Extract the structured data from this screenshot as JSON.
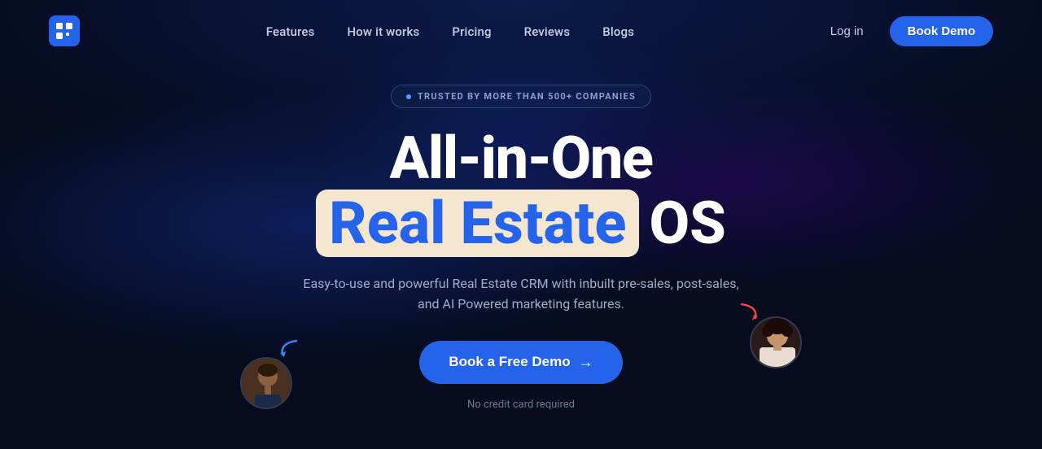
{
  "nav": {
    "logo_alt": "Reelo Logo",
    "links": [
      {
        "label": "Features",
        "href": "#"
      },
      {
        "label": "How it works",
        "href": "#"
      },
      {
        "label": "Pricing",
        "href": "#"
      },
      {
        "label": "Reviews",
        "href": "#"
      },
      {
        "label": "Blogs",
        "href": "#"
      }
    ],
    "login_label": "Log in",
    "book_demo_label": "Book Demo"
  },
  "hero": {
    "badge_text": "TRUSTED BY MORE THAN 500+ COMPANIES",
    "title_line1": "All-in-One",
    "title_highlight": "Real Estate",
    "title_suffix": "OS",
    "subtitle": "Easy-to-use and powerful Real Estate CRM with inbuilt pre-sales, post-sales, and AI Powered marketing features.",
    "cta_label": "Book a Free Demo",
    "cta_arrow": "→",
    "no_credit_text": "No credit card required"
  },
  "colors": {
    "accent": "#2563eb",
    "highlight_bg": "#f5e6d0",
    "highlight_text": "#2563eb",
    "bg_primary": "#060b1e"
  }
}
